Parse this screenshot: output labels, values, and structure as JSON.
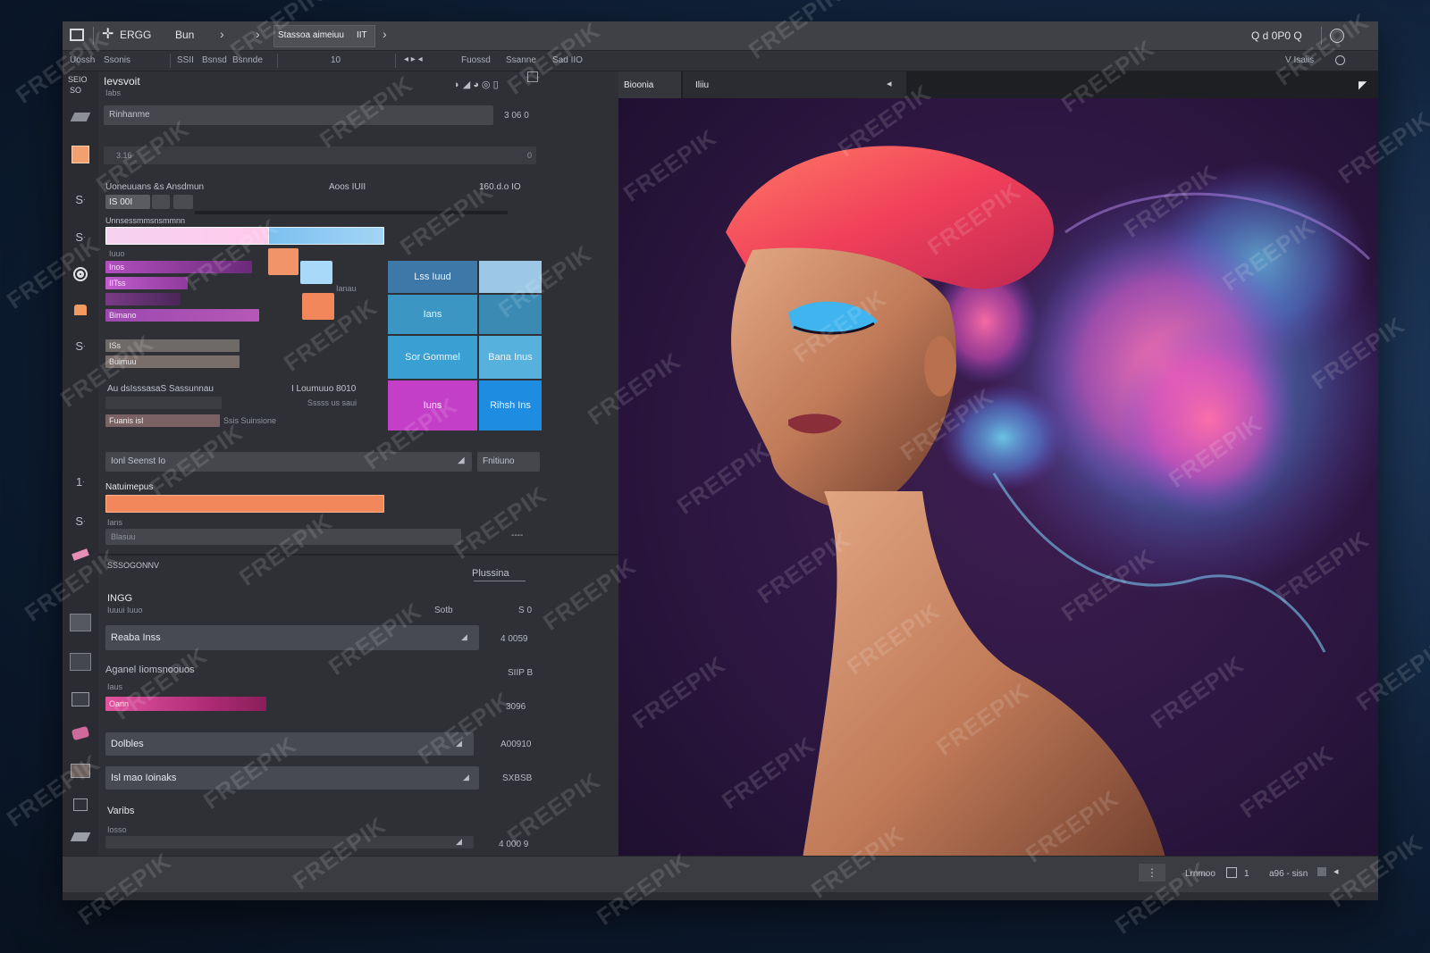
{
  "menubar": {
    "items": [
      "ERGG",
      "Bun"
    ],
    "doc_tab": "Stassoa aimeiuu",
    "doc_tab_suffix": "IIT",
    "zoom_readout": "Q d 0P0 Q"
  },
  "options_bar": {
    "items": [
      "Uossh",
      "Ssonis",
      "SSII",
      "Bsnsd",
      "Bsnnde",
      "10",
      "Fuossd",
      "Ssanne",
      "Sad IIO"
    ],
    "right": "V Isaiis"
  },
  "tool_labels": [
    "S",
    "S",
    "S",
    "1",
    "S"
  ],
  "panel": {
    "header_top": "SEIO",
    "header_sub": "SO",
    "title": "Ievsvoit",
    "title_sub": "Iabs",
    "field1_label": "Rinhanme",
    "field1_value": "3 06 0",
    "field2_label": "3.16",
    "field2_value": "0",
    "heading1": "Uoneuuans &s Ansdmun",
    "heading1_mid": "Aoos IUII",
    "heading1_right": "160.d.o IO",
    "chip1": "IS 00I",
    "heading2": "Unnsessmmsnsmmnn",
    "caption1": "Iuuo",
    "purple_labels": [
      "Inos",
      "IITss",
      "",
      "Bimano"
    ],
    "side_label": "Ianau",
    "gray_labels": [
      "ISs",
      "Buimuu"
    ],
    "line1": "Au dsIsssasaS Sassunnau",
    "line1_right": "I Loumuuo 8010",
    "line2": "Sssss us saui",
    "chip2": "Fuanis isI",
    "line3": "Ssis Suinsione",
    "tiles": [
      "Lss Iuud",
      "",
      "Ians",
      "",
      "Sor Gommel",
      "Bana Inus",
      "Iuns",
      "Rihsh Ins"
    ],
    "select_label": "Ionl Seenst Io",
    "select_button": "Fnitiuno",
    "heading3": "Natuimepus",
    "caption2": "Ians",
    "field3_label": "Blasuu",
    "field3_value": "----",
    "section_title": "SSSOGONNV",
    "section_right": "Plussina",
    "layers": [
      {
        "name": "INGG",
        "sub": "Iuuui Iuuo",
        "mid": "Sotb",
        "right": "S 0"
      },
      {
        "name": "Reaba Inss",
        "right": "4 0059"
      },
      {
        "name": "Aganel Iiomsnoouos",
        "sub": "Iaus",
        "right": "SIIP B"
      },
      {
        "name": "Oann",
        "right": "3096"
      },
      {
        "name": "Dolbles",
        "right": "A00910"
      },
      {
        "name": "Isl mao Ioinaks",
        "right": "SXBSB"
      },
      {
        "name": "Varibs",
        "sub": "Iosso",
        "right": "4 000 9"
      }
    ]
  },
  "canvas_tabs": [
    "Bioonia",
    "Iliiu"
  ],
  "status": {
    "left": "Lrnmoo",
    "left_num": "1",
    "right": "a96 - sisn"
  },
  "watermark": "FREEPIK",
  "colors": {
    "pink": "#c23cc7",
    "blue": "#1e8ad6",
    "orange": "#f0875a",
    "purple": "#9a40a4",
    "magenta": "#d84395",
    "lightblue": "#9dcfee"
  }
}
